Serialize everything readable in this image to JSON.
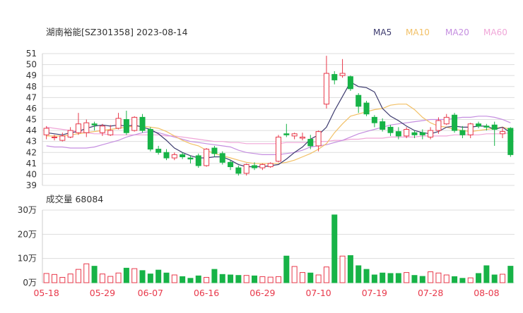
{
  "chart_data": {
    "type": "candlestick",
    "title": "湖南裕能[SZ301358] 2023-08-14",
    "legend": [
      {
        "label": "MA5",
        "color": "#3c3a6e"
      },
      {
        "label": "MA10",
        "color": "#f2c066"
      },
      {
        "label": "MA20",
        "color": "#c58ee0"
      },
      {
        "label": "MA60",
        "color": "#f0a6d8"
      }
    ],
    "colors": {
      "up": "#e8384a",
      "down": "#17b347",
      "grid": "#dddddd",
      "axis_text": "#333333",
      "date_text": "#e8384a"
    },
    "price_axis": {
      "ticks": [
        "51",
        "50",
        "49",
        "48",
        "47",
        "46",
        "45",
        "44",
        "43",
        "42",
        "41",
        "40",
        "39"
      ],
      "range": [
        39,
        51
      ]
    },
    "volume_axis": {
      "title": "成交量 68084",
      "ticks": [
        "30万",
        "20万",
        "10万",
        "0万"
      ],
      "range": [
        0,
        300000
      ]
    },
    "x_labels": [
      {
        "index": 0,
        "label": "05-18"
      },
      {
        "index": 7,
        "label": "05-29"
      },
      {
        "index": 13,
        "label": "06-07"
      },
      {
        "index": 20,
        "label": "06-16"
      },
      {
        "index": 27,
        "label": "06-29"
      },
      {
        "index": 34,
        "label": "07-10"
      },
      {
        "index": 41,
        "label": "07-19"
      },
      {
        "index": 48,
        "label": "07-28"
      },
      {
        "index": 55,
        "label": "08-08"
      }
    ],
    "ohlc": [
      [
        43.6,
        44.2,
        44.4,
        43.2
      ],
      [
        43.4,
        43.4,
        43.6,
        43.1
      ],
      [
        43.1,
        43.5,
        43.8,
        43.0
      ],
      [
        43.4,
        44.0,
        44.3,
        43.3
      ],
      [
        43.8,
        44.6,
        45.6,
        43.6
      ],
      [
        43.8,
        44.7,
        45.0,
        43.4
      ],
      [
        44.6,
        44.5,
        44.8,
        44.0
      ],
      [
        43.8,
        44.4,
        44.6,
        43.5
      ],
      [
        43.6,
        44.0,
        44.5,
        43.5
      ],
      [
        44.2,
        45.1,
        45.6,
        44.1
      ],
      [
        45.0,
        43.8,
        45.8,
        43.6
      ],
      [
        44.0,
        45.2,
        45.3,
        43.9
      ],
      [
        45.2,
        44.0,
        45.5,
        43.8
      ],
      [
        44.1,
        42.3,
        44.3,
        42.1
      ],
      [
        42.3,
        42.0,
        42.6,
        41.8
      ],
      [
        42.0,
        41.5,
        42.3,
        41.3
      ],
      [
        41.5,
        41.8,
        42.0,
        41.3
      ],
      [
        41.8,
        41.6,
        42.0,
        41.4
      ],
      [
        41.5,
        41.4,
        41.7,
        41.0
      ],
      [
        41.7,
        40.8,
        41.9,
        40.6
      ],
      [
        40.8,
        42.3,
        42.4,
        40.7
      ],
      [
        42.4,
        41.9,
        42.6,
        41.6
      ],
      [
        41.9,
        41.1,
        42.1,
        40.9
      ],
      [
        41.1,
        40.7,
        41.3,
        40.4
      ],
      [
        40.6,
        40.1,
        40.8,
        39.9
      ],
      [
        40.1,
        40.9,
        41.0,
        39.9
      ],
      [
        40.8,
        40.6,
        41.1,
        40.4
      ],
      [
        40.6,
        40.9,
        41.0,
        40.4
      ],
      [
        40.7,
        41.0,
        41.1,
        40.6
      ],
      [
        41.2,
        43.4,
        43.6,
        41.1
      ],
      [
        43.7,
        43.6,
        44.6,
        43.4
      ],
      [
        43.5,
        43.7,
        43.8,
        43.2
      ],
      [
        43.3,
        43.4,
        43.8,
        43.1
      ],
      [
        43.2,
        42.6,
        43.6,
        42.3
      ],
      [
        42.6,
        43.9,
        44.0,
        42.1
      ],
      [
        46.4,
        49.2,
        50.8,
        46.0
      ],
      [
        49.1,
        48.6,
        49.4,
        48.2
      ],
      [
        49.0,
        49.2,
        50.5,
        48.8
      ],
      [
        48.9,
        47.8,
        49.0,
        47.6
      ],
      [
        47.2,
        46.2,
        47.4,
        45.6
      ],
      [
        46.5,
        45.5,
        46.7,
        45.3
      ],
      [
        45.2,
        44.7,
        45.4,
        44.3
      ],
      [
        44.8,
        44.1,
        45.1,
        43.9
      ],
      [
        44.3,
        43.8,
        44.5,
        43.5
      ],
      [
        43.9,
        43.5,
        44.3,
        43.2
      ],
      [
        43.5,
        44.1,
        44.3,
        43.3
      ],
      [
        43.8,
        43.6,
        44.0,
        43.3
      ],
      [
        43.8,
        43.6,
        44.1,
        43.2
      ],
      [
        43.4,
        44.0,
        44.3,
        43.2
      ],
      [
        44.0,
        44.9,
        45.2,
        43.7
      ],
      [
        44.6,
        45.2,
        45.5,
        44.5
      ],
      [
        45.4,
        44.0,
        45.6,
        43.8
      ],
      [
        44.0,
        43.6,
        44.4,
        43.3
      ],
      [
        43.6,
        44.6,
        44.7,
        43.3
      ],
      [
        44.6,
        44.4,
        44.8,
        44.2
      ],
      [
        44.4,
        44.3,
        44.6,
        44.0
      ],
      [
        44.5,
        44.1,
        44.8,
        42.6
      ],
      [
        43.7,
        43.9,
        44.3,
        43.3
      ],
      [
        44.2,
        41.8,
        44.3,
        41.6
      ]
    ],
    "volume": [
      38000,
      34000,
      22000,
      36000,
      55000,
      78000,
      68000,
      36000,
      26000,
      40000,
      60000,
      58000,
      50000,
      36000,
      52000,
      40000,
      32000,
      25000,
      18000,
      28000,
      22000,
      55000,
      34000,
      32000,
      30000,
      30000,
      28000,
      25000,
      23000,
      25000,
      110000,
      67000,
      42000,
      40000,
      32000,
      65000,
      280000,
      110000,
      112000,
      70000,
      55000,
      32000,
      40000,
      38000,
      38000,
      42000,
      30000,
      26000,
      45000,
      40000,
      32000,
      25000,
      18000,
      20000,
      38000,
      70000,
      32000,
      35000,
      68084
    ],
    "ma5": [
      43.8,
      43.7,
      43.6,
      43.8,
      43.9,
      44.2,
      44.4,
      44.5,
      44.4,
      44.5,
      44.4,
      44.5,
      44.3,
      44.1,
      43.7,
      43.1,
      42.4,
      42.0,
      41.7,
      41.5,
      41.5,
      41.6,
      41.6,
      41.3,
      40.9,
      40.7,
      40.7,
      40.7,
      40.8,
      40.9,
      41.4,
      42.0,
      42.5,
      43.2,
      43.6,
      44.3,
      45.8,
      47.1,
      48.4,
      48.0,
      47.9,
      47.5,
      46.0,
      45.3,
      44.9,
      44.4,
      44.0,
      43.8,
      43.7,
      43.9,
      44.3,
      44.4,
      44.3,
      44.3,
      44.4,
      44.4,
      44.1,
      44.3,
      43.8
    ],
    "ma10": [
      43.5,
      43.5,
      43.5,
      43.6,
      43.7,
      43.8,
      43.9,
      44.0,
      44.1,
      44.2,
      44.3,
      44.4,
      44.4,
      44.3,
      44.2,
      43.9,
      43.5,
      43.1,
      42.8,
      42.6,
      42.2,
      41.9,
      41.7,
      41.5,
      41.3,
      41.1,
      41.0,
      41.0,
      41.0,
      41.0,
      41.1,
      41.3,
      41.6,
      41.9,
      42.3,
      42.8,
      43.8,
      44.6,
      45.3,
      45.5,
      45.7,
      45.9,
      46.0,
      46.3,
      46.4,
      46.4,
      45.9,
      45.2,
      44.7,
      44.4,
      44.3,
      44.1,
      44.0,
      43.9,
      44.0,
      44.1,
      44.2,
      44.3,
      44.1
    ],
    "ma20": [
      42.6,
      42.5,
      42.5,
      42.4,
      42.4,
      42.4,
      42.5,
      42.7,
      42.9,
      43.1,
      43.4,
      43.6,
      43.8,
      43.9,
      43.8,
      43.6,
      43.4,
      43.2,
      43.0,
      42.9,
      42.8,
      42.7,
      42.6,
      42.5,
      42.2,
      42.0,
      41.9,
      41.8,
      41.8,
      41.8,
      41.9,
      42.0,
      42.2,
      42.5,
      42.6,
      42.7,
      42.9,
      43.1,
      43.4,
      43.7,
      43.9,
      44.1,
      44.3,
      44.5,
      44.6,
      44.7,
      44.8,
      44.9,
      45.0,
      45.0,
      45.0,
      45.1,
      45.2,
      45.2,
      45.3,
      45.3,
      45.2,
      45.0,
      44.7
    ],
    "ma60": [
      44.3,
      44.2,
      44.1,
      44.0,
      43.9,
      43.8,
      43.7,
      43.7,
      43.6,
      43.6,
      43.6,
      43.6,
      43.6,
      43.6,
      43.6,
      43.5,
      43.5,
      43.4,
      43.3,
      43.2,
      43.1,
      43.0,
      43.0,
      42.9,
      42.9,
      42.8,
      42.8,
      42.8,
      42.8,
      42.8,
      42.9,
      42.9,
      42.9,
      42.9,
      43.0,
      43.0,
      43.1,
      43.1,
      43.2,
      43.2,
      43.3,
      43.3,
      43.3,
      43.4,
      43.4,
      43.4,
      43.4,
      43.5,
      43.5,
      43.5,
      43.5,
      43.6,
      43.6,
      43.6,
      43.6,
      43.7,
      43.7,
      43.7,
      43.8
    ]
  }
}
